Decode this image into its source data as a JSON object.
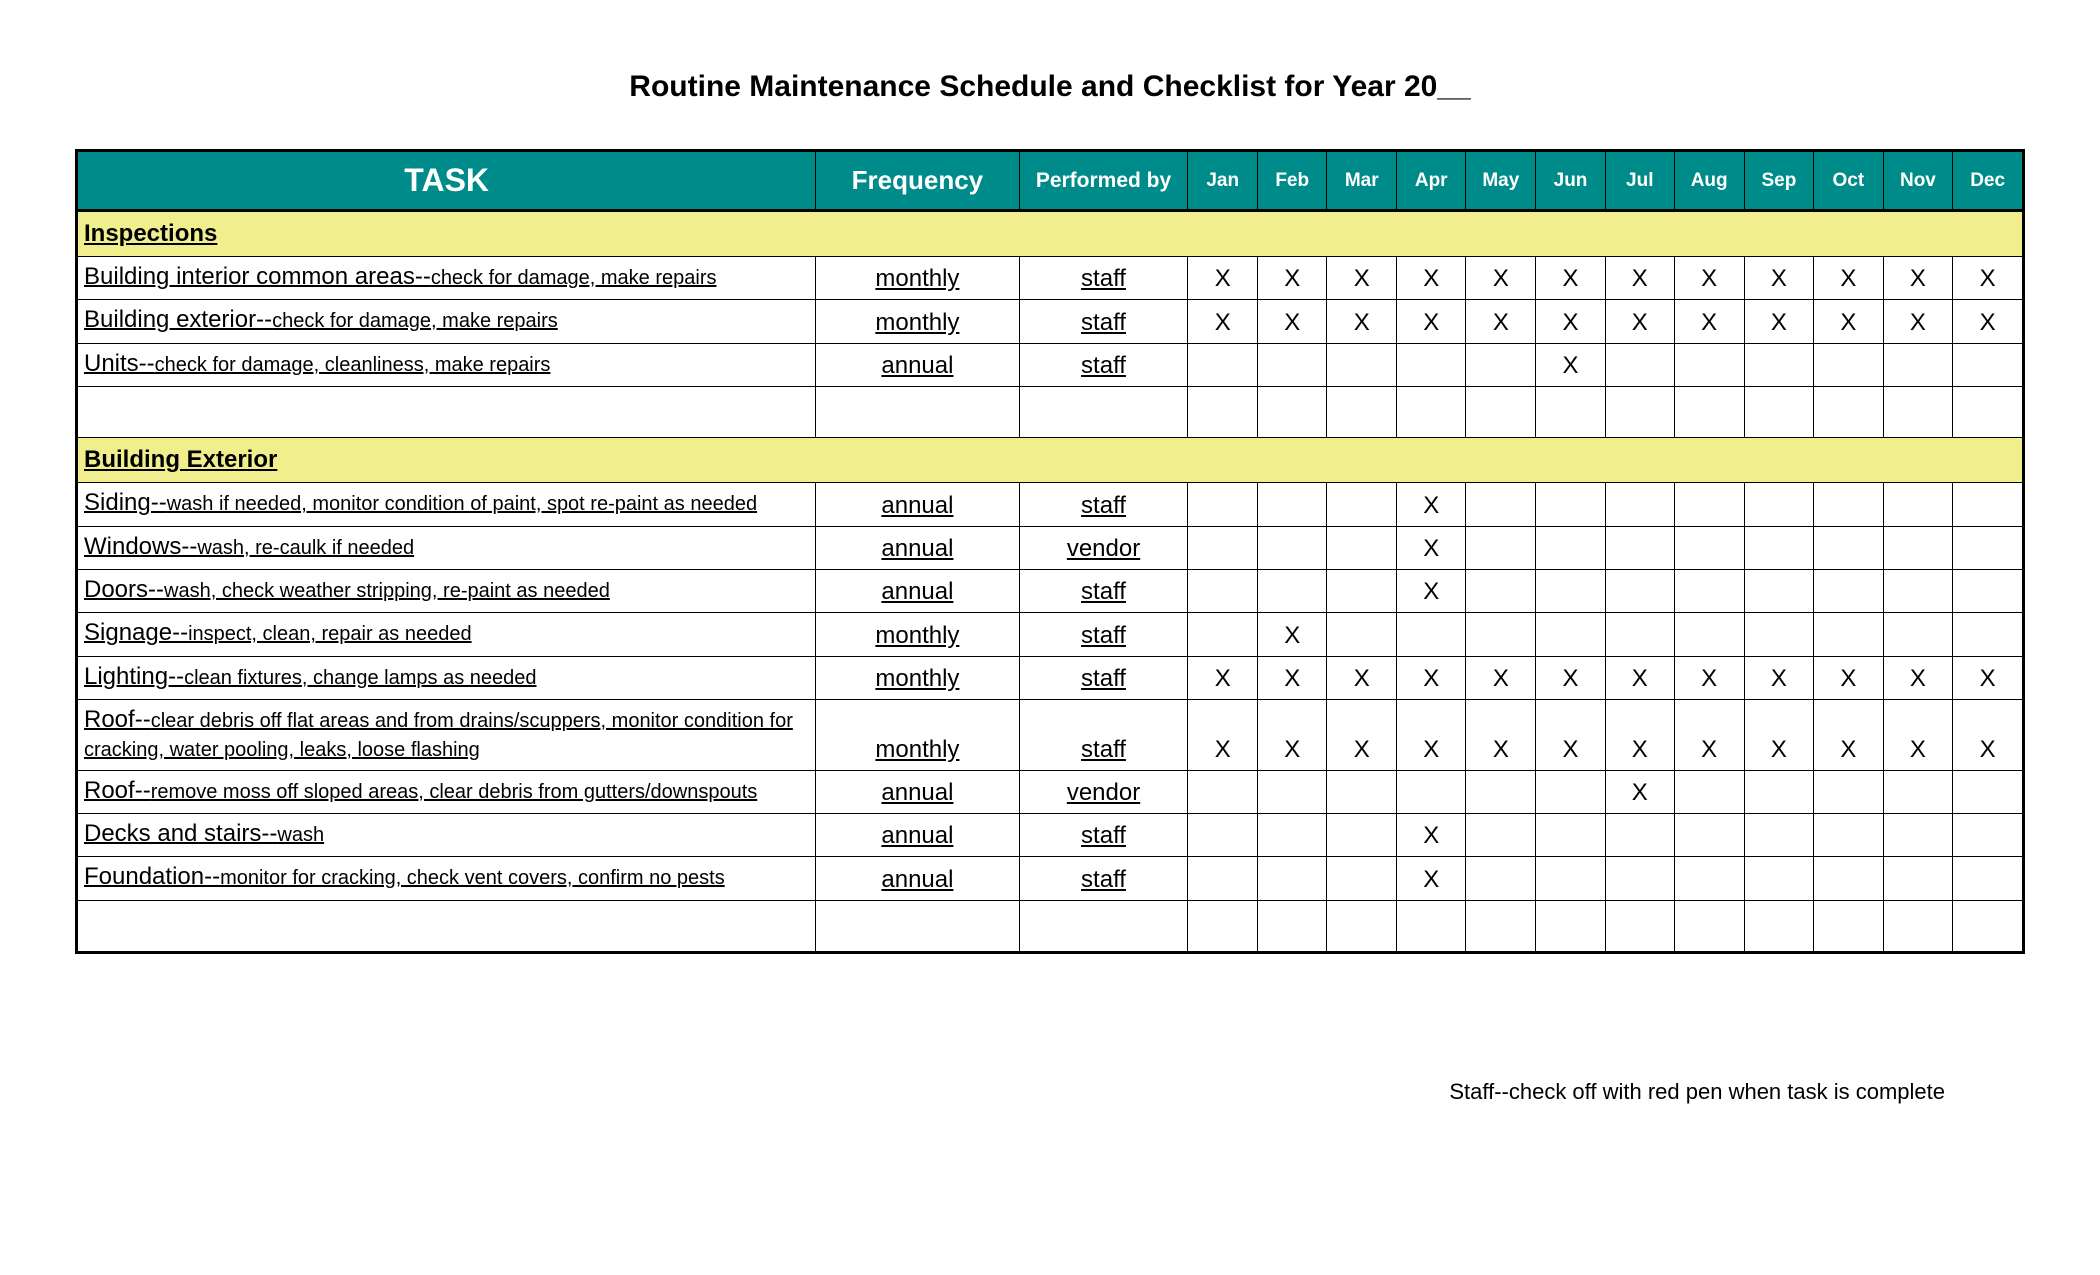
{
  "title": "Routine Maintenance Schedule and Checklist for Year 20__",
  "columns": {
    "task": "TASK",
    "frequency": "Frequency",
    "performed_by": "Performed by",
    "months": [
      "Jan",
      "Feb",
      "Mar",
      "Apr",
      "May",
      "Jun",
      "Jul",
      "Aug",
      "Sep",
      "Oct",
      "Nov",
      "Dec"
    ]
  },
  "mark": "X",
  "sections": [
    {
      "name": "Inspections",
      "rows": [
        {
          "task_head": "Building interior common areas--",
          "task_desc": "check for damage, make repairs",
          "frequency": "monthly",
          "performed_by": "staff",
          "months": [
            true,
            true,
            true,
            true,
            true,
            true,
            true,
            true,
            true,
            true,
            true,
            true
          ]
        },
        {
          "task_head": "Building exterior--",
          "task_desc": "check for damage, make repairs",
          "frequency": "monthly",
          "performed_by": "staff",
          "months": [
            true,
            true,
            true,
            true,
            true,
            true,
            true,
            true,
            true,
            true,
            true,
            true
          ]
        },
        {
          "task_head": "Units--",
          "task_desc": "check for damage, cleanliness, make repairs",
          "frequency": "annual",
          "performed_by": "staff",
          "months": [
            false,
            false,
            false,
            false,
            false,
            true,
            false,
            false,
            false,
            false,
            false,
            false
          ]
        }
      ],
      "trailing_blank": true
    },
    {
      "name": "Building Exterior",
      "rows": [
        {
          "task_head": "Siding--",
          "task_desc": "wash if needed, monitor condition of paint, spot re-paint as needed",
          "frequency": "annual",
          "performed_by": "staff",
          "months": [
            false,
            false,
            false,
            true,
            false,
            false,
            false,
            false,
            false,
            false,
            false,
            false
          ]
        },
        {
          "task_head": "Windows--",
          "task_desc": "wash, re-caulk if needed",
          "frequency": "annual",
          "performed_by": "vendor",
          "months": [
            false,
            false,
            false,
            true,
            false,
            false,
            false,
            false,
            false,
            false,
            false,
            false
          ]
        },
        {
          "task_head": "Doors--",
          "task_desc": "wash, check weather stripping, re-paint as needed",
          "frequency": "annual",
          "performed_by": "staff",
          "months": [
            false,
            false,
            false,
            true,
            false,
            false,
            false,
            false,
            false,
            false,
            false,
            false
          ]
        },
        {
          "task_head": "Signage--",
          "task_desc": "inspect, clean, repair as needed",
          "frequency": "monthly",
          "performed_by": "staff",
          "months": [
            false,
            true,
            false,
            false,
            false,
            false,
            false,
            false,
            false,
            false,
            false,
            false
          ]
        },
        {
          "task_head": "Lighting--",
          "task_desc": "clean fixtures, change lamps as needed",
          "frequency": "monthly",
          "performed_by": "staff",
          "months": [
            true,
            true,
            true,
            true,
            true,
            true,
            true,
            true,
            true,
            true,
            true,
            true
          ]
        },
        {
          "task_head": "Roof--",
          "task_desc": "clear debris off flat areas and from drains/scuppers, monitor condition for cracking, water pooling, leaks, loose flashing",
          "frequency": "monthly",
          "performed_by": "staff",
          "months": [
            true,
            true,
            true,
            true,
            true,
            true,
            true,
            true,
            true,
            true,
            true,
            true
          ]
        },
        {
          "task_head": "Roof--",
          "task_desc": "remove moss off sloped areas, clear debris from gutters/downspouts",
          "frequency": "annual",
          "performed_by": "vendor",
          "months": [
            false,
            false,
            false,
            false,
            false,
            false,
            true,
            false,
            false,
            false,
            false,
            false
          ]
        },
        {
          "task_head": "Decks and stairs--",
          "task_desc": "wash",
          "frequency": "annual",
          "performed_by": "staff",
          "months": [
            false,
            false,
            false,
            true,
            false,
            false,
            false,
            false,
            false,
            false,
            false,
            false
          ]
        },
        {
          "task_head": "Foundation--",
          "task_desc": "monitor for cracking, check vent covers, confirm no pests",
          "frequency": "annual",
          "performed_by": "staff",
          "months": [
            false,
            false,
            false,
            true,
            false,
            false,
            false,
            false,
            false,
            false,
            false,
            false
          ]
        }
      ],
      "trailing_blank": true
    }
  ],
  "footnote": "Staff--check off with red pen when task is complete"
}
